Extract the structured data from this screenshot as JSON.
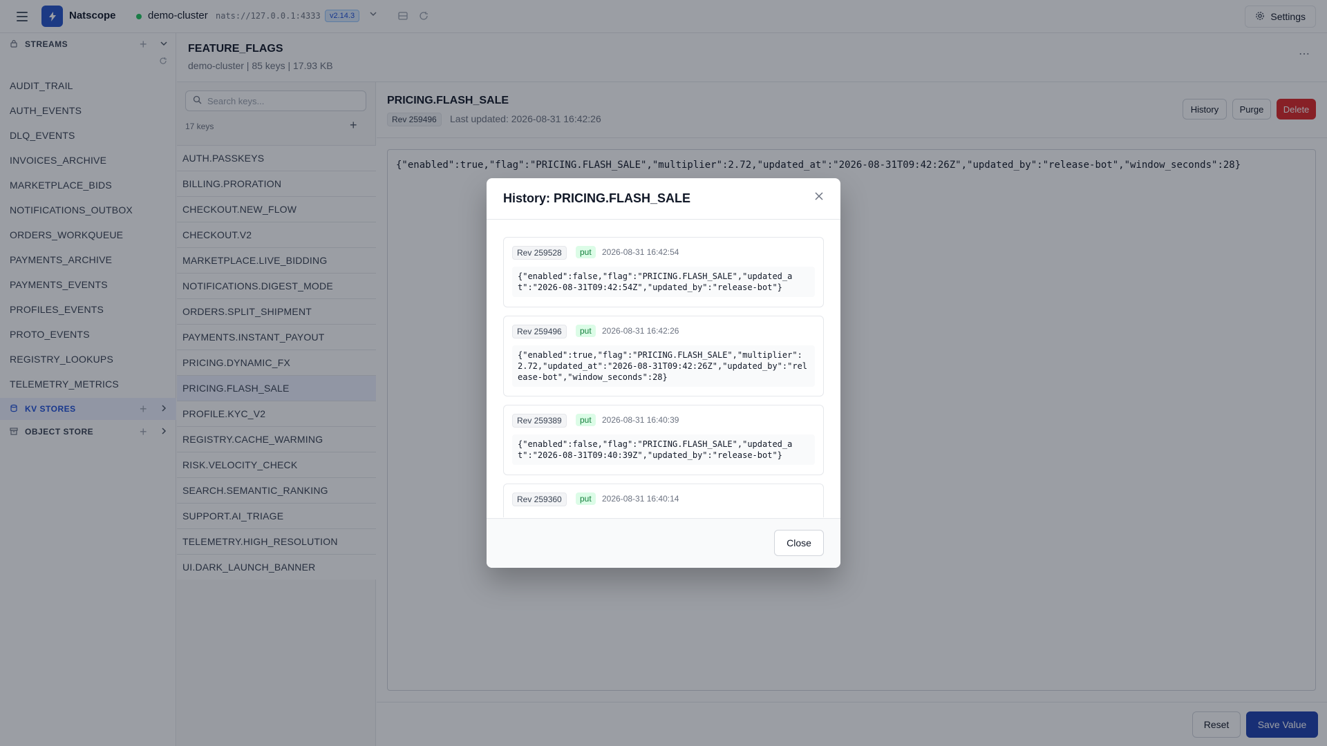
{
  "topbar": {
    "app_name": "Natscope",
    "cluster_name": "demo-cluster",
    "cluster_url": "nats://127.0.0.1:4333",
    "version": "v2.14.3",
    "settings_label": "Settings"
  },
  "sidebar": {
    "streams_label": "STREAMS",
    "streams": [
      "AUDIT_TRAIL",
      "AUTH_EVENTS",
      "DLQ_EVENTS",
      "INVOICES_ARCHIVE",
      "MARKETPLACE_BIDS",
      "NOTIFICATIONS_OUTBOX",
      "ORDERS_WORKQUEUE",
      "PAYMENTS_ARCHIVE",
      "PAYMENTS_EVENTS",
      "PROFILES_EVENTS",
      "PROTO_EVENTS",
      "REGISTRY_LOOKUPS",
      "TELEMETRY_METRICS"
    ],
    "kv_label": "KV STORES",
    "object_label": "OBJECT STORE"
  },
  "bucket": {
    "name": "FEATURE_FLAGS",
    "subtitle": "demo-cluster  | 85 keys | 17.93 KB"
  },
  "keys": {
    "search_placeholder": "Search keys...",
    "count": "17 keys",
    "items": [
      "AUTH.PASSKEYS",
      "BILLING.PRORATION",
      "CHECKOUT.NEW_FLOW",
      "CHECKOUT.V2",
      "MARKETPLACE.LIVE_BIDDING",
      "NOTIFICATIONS.DIGEST_MODE",
      "ORDERS.SPLIT_SHIPMENT",
      "PAYMENTS.INSTANT_PAYOUT",
      "PRICING.DYNAMIC_FX",
      "PRICING.FLASH_SALE",
      "PROFILE.KYC_V2",
      "REGISTRY.CACHE_WARMING",
      "RISK.VELOCITY_CHECK",
      "SEARCH.SEMANTIC_RANKING",
      "SUPPORT.AI_TRIAGE",
      "TELEMETRY.HIGH_RESOLUTION",
      "UI.DARK_LAUNCH_BANNER"
    ],
    "selected": "PRICING.FLASH_SALE"
  },
  "detail": {
    "key": "PRICING.FLASH_SALE",
    "rev": "Rev 259496",
    "last_updated": "Last updated: 2026-08-31 16:42:26",
    "history_label": "History",
    "purge_label": "Purge",
    "delete_label": "Delete",
    "value": "{\"enabled\":true,\"flag\":\"PRICING.FLASH_SALE\",\"multiplier\":2.72,\"updated_at\":\"2026-08-31T09:42:26Z\",\"updated_by\":\"release-bot\",\"window_seconds\":28}",
    "reset_label": "Reset",
    "save_label": "Save Value"
  },
  "modal": {
    "title": "History: PRICING.FLASH_SALE",
    "close_label": "Close",
    "entries": [
      {
        "rev": "Rev 259528",
        "op": "put",
        "time": "2026-08-31 16:42:54",
        "value": "{\"enabled\":false,\"flag\":\"PRICING.FLASH_SALE\",\"updated_at\":\"2026-08-31T09:42:54Z\",\"updated_by\":\"release-bot\"}"
      },
      {
        "rev": "Rev 259496",
        "op": "put",
        "time": "2026-08-31 16:42:26",
        "value": "{\"enabled\":true,\"flag\":\"PRICING.FLASH_SALE\",\"multiplier\":2.72,\"updated_at\":\"2026-08-31T09:42:26Z\",\"updated_by\":\"release-bot\",\"window_seconds\":28}"
      },
      {
        "rev": "Rev 259389",
        "op": "put",
        "time": "2026-08-31 16:40:39",
        "value": "{\"enabled\":false,\"flag\":\"PRICING.FLASH_SALE\",\"updated_at\":\"2026-08-31T09:40:39Z\",\"updated_by\":\"release-bot\"}"
      },
      {
        "rev": "Rev 259360",
        "op": "put",
        "time": "2026-08-31 16:40:14",
        "value": ""
      }
    ]
  },
  "colors": {
    "brand": "#2553c9",
    "danger": "#dc2626",
    "primary": "#1e40af",
    "status_ok": "#22c55e"
  }
}
